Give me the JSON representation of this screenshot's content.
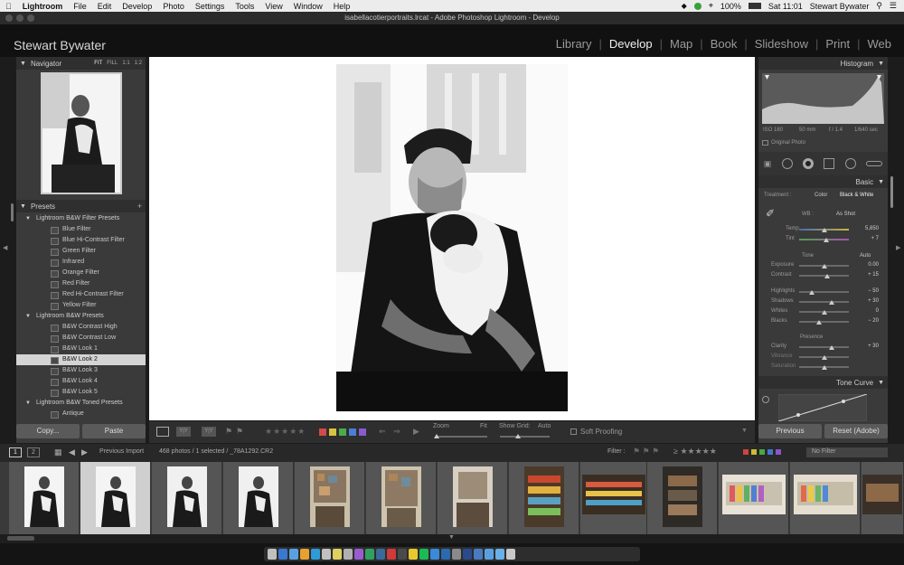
{
  "menubar": {
    "apple": "",
    "app_name": "Lightroom",
    "items": [
      "File",
      "Edit",
      "Develop",
      "Photo",
      "Settings",
      "Tools",
      "View",
      "Window",
      "Help"
    ],
    "battery": "100%",
    "clock": "Sat 11:01",
    "user": "Stewart Bywater"
  },
  "window": {
    "title": "isabellacotierportraits.lrcat - Adobe Photoshop Lightroom - Develop"
  },
  "identity": {
    "name": "Stewart Bywater"
  },
  "modules": [
    {
      "label": "Library",
      "active": false
    },
    {
      "label": "Develop",
      "active": true
    },
    {
      "label": "Map",
      "active": false
    },
    {
      "label": "Book",
      "active": false
    },
    {
      "label": "Slideshow",
      "active": false
    },
    {
      "label": "Print",
      "active": false
    },
    {
      "label": "Web",
      "active": false
    }
  ],
  "navigator": {
    "title": "Navigator",
    "opts": [
      "FIT",
      "FILL",
      "1:1",
      "1:2"
    ]
  },
  "presets": {
    "title": "Presets",
    "groups": [
      {
        "name": "Lightroom B&W Filter Presets",
        "items": [
          "Blue Filter",
          "Blue Hi-Contrast Filter",
          "Green Filter",
          "Infrared",
          "Orange Filter",
          "Red Filter",
          "Red Hi-Contrast Filter",
          "Yellow Filter"
        ]
      },
      {
        "name": "Lightroom B&W Presets",
        "items": [
          "B&W Contrast High",
          "B&W Contrast Low",
          "B&W Look 1",
          "B&W Look 2",
          "B&W Look 3",
          "B&W Look 4",
          "B&W Look 5"
        ]
      },
      {
        "name": "Lightroom B&W Toned Presets",
        "items": [
          "Antique"
        ]
      }
    ],
    "selected": "B&W Look 2"
  },
  "left_buttons": {
    "copy": "Copy...",
    "paste": "Paste"
  },
  "histogram": {
    "title": "Histogram",
    "iso": "ISO 180",
    "focal": "50 mm",
    "aperture": "f / 1.4",
    "shutter": "1/640 sec",
    "original": "Original Photo"
  },
  "basic": {
    "title": "Basic",
    "treatment_label": "Treatment :",
    "treatment_color": "Color",
    "treatment_bw": "Black & White",
    "wb_label": "WB :",
    "wb_value": "As Shot",
    "temp_label": "Temp",
    "temp_value": "5,850",
    "tint_label": "Tint",
    "tint_value": "+ 7",
    "tone_label": "Tone",
    "auto_label": "Auto",
    "sliders": [
      {
        "label": "Exposure",
        "value": "0.00",
        "pos": 0.5
      },
      {
        "label": "Contrast",
        "value": "+ 15",
        "pos": 0.56
      },
      {
        "label": "Highlights",
        "value": "− 50",
        "pos": 0.25
      },
      {
        "label": "Shadows",
        "value": "+ 30",
        "pos": 0.65
      },
      {
        "label": "Whites",
        "value": "0",
        "pos": 0.5
      },
      {
        "label": "Blacks",
        "value": "− 20",
        "pos": 0.4
      },
      {
        "label": "Clarity",
        "value": "+ 30",
        "pos": 0.65
      },
      {
        "label": "Vibrance",
        "value": "",
        "pos": 0.5
      },
      {
        "label": "Saturation",
        "value": "",
        "pos": 0.5
      }
    ],
    "presence_label": "Presence"
  },
  "tone_curve": {
    "title": "Tone Curve"
  },
  "right_buttons": {
    "previous": "Previous",
    "reset": "Reset (Adobe)"
  },
  "toolbar": {
    "zoom_label": "Zoom",
    "zoom_value": "Fit",
    "grid_label": "Show Grid:",
    "grid_value": "Auto",
    "soft_proofing": "Soft Proofing",
    "labels_colors": [
      "#d24a4a",
      "#d8c341",
      "#4cab4c",
      "#4a7fd2",
      "#8a5ad0"
    ]
  },
  "filmstrip": {
    "page1": "1",
    "page2": "2",
    "source": "Previous Import",
    "info": "468 photos / 1 selected / _78A1292.CR2",
    "filter_label": "Filter :",
    "filter_value": "No Filter"
  }
}
